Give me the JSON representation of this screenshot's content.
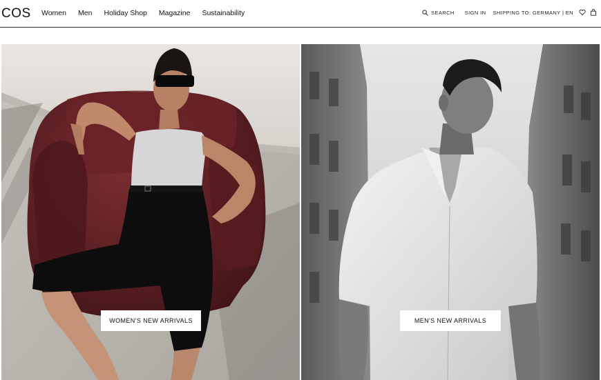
{
  "header": {
    "logo": "COS",
    "nav": [
      {
        "label": "Women"
      },
      {
        "label": "Men"
      },
      {
        "label": "Holiday Shop"
      },
      {
        "label": "Magazine"
      },
      {
        "label": "Sustainability"
      }
    ],
    "search_label": "SEARCH",
    "signin_label": "SIGN IN",
    "shipping_label": "SHIPPING TO: GERMANY | EN"
  },
  "hero": {
    "women_cta": "WOMEN'S NEW ARRIVALS",
    "men_cta": "MEN'S NEW ARRIVALS"
  },
  "colors": {
    "text": "#111111",
    "divider": "#2a2a2a",
    "sofa": "#5e1f24",
    "background": "#ffffff"
  },
  "icons": {
    "search": "search-icon",
    "wishlist": "heart-icon",
    "bag": "bag-icon"
  }
}
